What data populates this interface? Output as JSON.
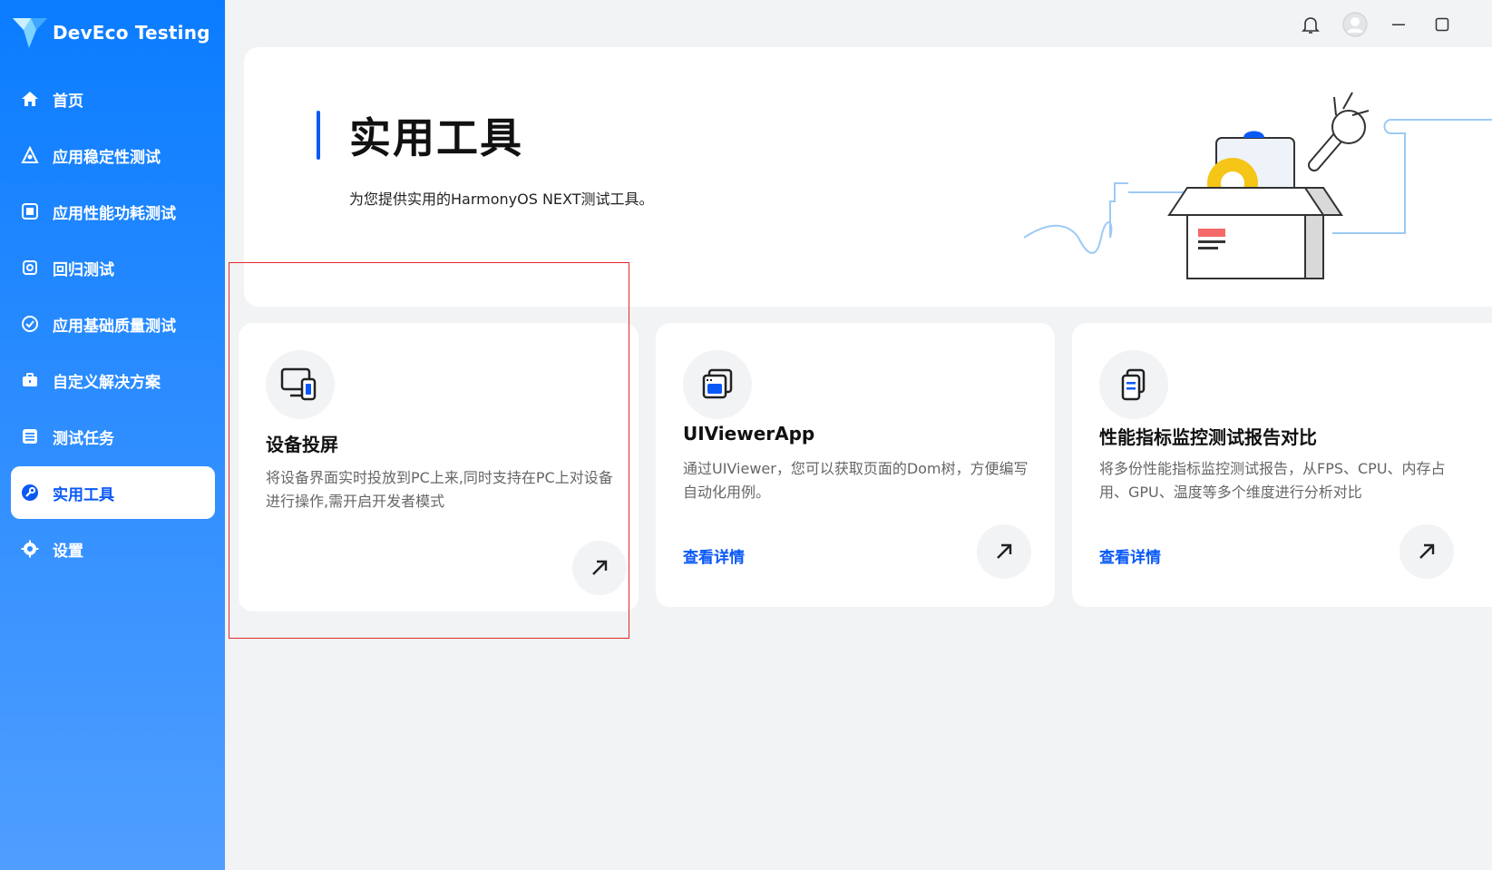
{
  "app": {
    "name": "DevEco Testing"
  },
  "sidebar": {
    "items": [
      {
        "label": "首页",
        "icon": "home-icon"
      },
      {
        "label": "应用稳定性测试",
        "icon": "stability-icon"
      },
      {
        "label": "应用性能功耗测试",
        "icon": "performance-icon"
      },
      {
        "label": "回归测试",
        "icon": "regression-icon"
      },
      {
        "label": "应用基础质量测试",
        "icon": "check-circle-icon"
      },
      {
        "label": "自定义解决方案",
        "icon": "toolbox-icon"
      },
      {
        "label": "测试任务",
        "icon": "list-icon"
      },
      {
        "label": "实用工具",
        "icon": "wrench-icon",
        "active": true
      },
      {
        "label": "设置",
        "icon": "gear-icon"
      }
    ]
  },
  "topbar": {
    "icons": [
      "bell-icon",
      "avatar-icon",
      "minimize-icon",
      "maximize-icon"
    ]
  },
  "hero": {
    "title": "实用工具",
    "subtitle": "为您提供实用的HarmonyOS NEXT测试工具。"
  },
  "cards": [
    {
      "title": "设备投屏",
      "description": "将设备界面实时投放到PC上来,同时支持在PC上对设备进行操作,需开启开发者模式",
      "link": "",
      "icon": "screen-cast-icon"
    },
    {
      "title": "UIViewerApp",
      "description": "通过UIViewer，您可以获取页面的Dom树，方便编写自动化用例。",
      "link": "查看详情",
      "icon": "ui-viewer-icon"
    },
    {
      "title": "性能指标监控测试报告对比",
      "description": "将多份性能指标监控测试报告，从FPS、CPU、内存占用、GPU、温度等多个维度进行分析对比",
      "link": "查看详情",
      "icon": "report-compare-icon"
    }
  ],
  "colors": {
    "accent": "#0a59f7",
    "sidebar_top": "#0a7cff",
    "sidebar_bottom": "#4f9eff",
    "highlight": "#e6262e"
  }
}
